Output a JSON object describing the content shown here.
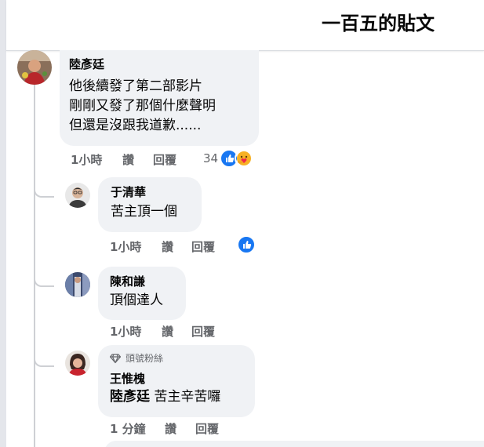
{
  "header": {
    "title": "一百五的貼文"
  },
  "comments": [
    {
      "author": "陸彥廷",
      "lines": [
        "他後續發了第二部影片",
        "剛剛又發了那個什麼聲明",
        "但還是沒跟我道歉......"
      ],
      "time": "1小時",
      "like_label": "讚",
      "reply_label": "回覆",
      "reaction_count": "34",
      "reactions": [
        "like-icon",
        "care-icon"
      ]
    },
    {
      "author": "于清華",
      "lines": [
        "苦主頂一個"
      ],
      "time": "1小時",
      "like_label": "讚",
      "reply_label": "回覆",
      "reactions": [
        "like-icon"
      ]
    },
    {
      "author": "陳和謙",
      "lines": [
        "頂個達人"
      ],
      "time": "1小時",
      "like_label": "讚",
      "reply_label": "回覆"
    },
    {
      "badge": "頭號粉絲",
      "author": "王惟槐",
      "mention": "陸彥廷",
      "text": "苦主辛苦囉",
      "time": "1 分鐘",
      "like_label": "讚",
      "reply_label": "回覆"
    }
  ],
  "colors": {
    "bubble": "#f0f2f5",
    "secondary_text": "#65676b",
    "like_blue": "#1877f2",
    "thread_line": "#ced0d4"
  }
}
